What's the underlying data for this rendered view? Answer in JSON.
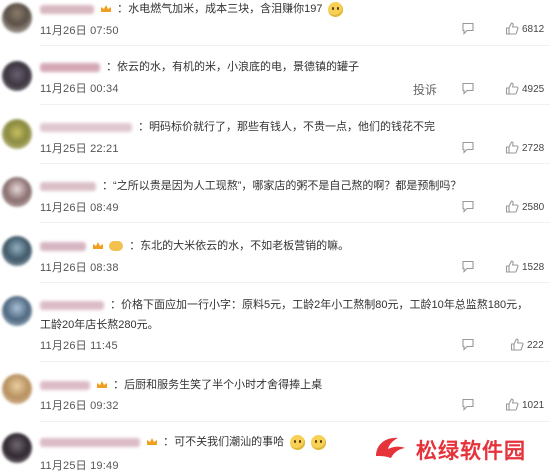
{
  "comments": [
    {
      "text": "：水电燃气加米，成本三块，含泪赚你197",
      "date": "11月26日 07:50",
      "likes": "6812"
    },
    {
      "text": "：依云的水，有机的米，小浪底的电，景德镇的罐子",
      "date": "11月26日 00:34",
      "likes": "4925",
      "report_label": "投诉"
    },
    {
      "text": "：明码标价就行了，那些有钱人，不贵一点，他们的钱花不完",
      "date": "11月25日 22:21",
      "likes": "2728"
    },
    {
      "text": "：“之所以贵是因为人工现熬”，哪家店的粥不是自己熬的啊？都是预制吗？",
      "date": "11月26日 08:49",
      "likes": "2580"
    },
    {
      "text": "：东北的大米依云的水，不如老板营销的嘛。",
      "date": "11月26日 08:38",
      "likes": "1528"
    },
    {
      "text": "：价格下面应加一行小字：原料5元，工龄2年小工熬制80元，工龄10年总监熬180元，",
      "text_line2": "工龄20年店长熬280元。",
      "date": "11月26日 11:45",
      "likes": "222"
    },
    {
      "text": "：后厨和服务生笑了半个小时才舍得捧上桌",
      "date": "11月26日 09:32",
      "likes": "1021"
    },
    {
      "text": "：可不关我们潮汕的事哈",
      "date": "11月25日 19:49",
      "likes": ""
    }
  ],
  "watermark": {
    "text": "松绿软件园"
  },
  "colors": {
    "crown": "#f0a020",
    "text": "#333333",
    "meta": "#555555",
    "watermark": "#e6323a"
  },
  "icons": [
    "reply-icon",
    "like-icon",
    "crown-icon",
    "emoji-icon",
    "watermark-logo-icon"
  ]
}
